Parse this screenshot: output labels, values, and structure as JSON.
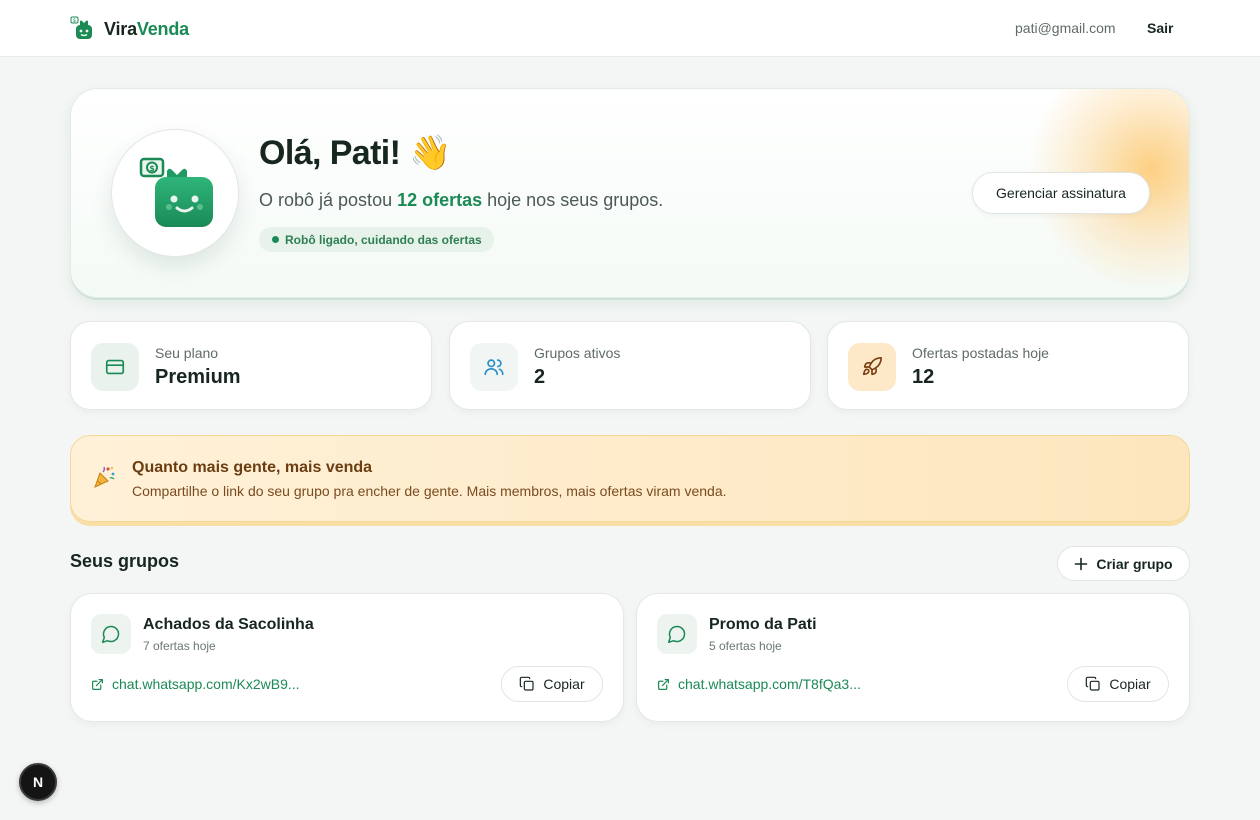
{
  "header": {
    "brand_part1": "Vira",
    "brand_part2": "Venda",
    "user_email": "pati@gmail.com",
    "logout_label": "Sair"
  },
  "hero": {
    "greeting": "Olá, Pati!",
    "greeting_emoji": "👋",
    "subtitle_prefix": "O robô já postou ",
    "subtitle_highlight": "12 ofertas",
    "subtitle_suffix": " hoje nos seus grupos.",
    "status_label": "Robô ligado, cuidando das ofertas",
    "manage_button": "Gerenciar assinatura"
  },
  "stats": [
    {
      "label": "Seu plano",
      "value": "Premium",
      "icon": "credit-card-icon"
    },
    {
      "label": "Grupos ativos",
      "value": "2",
      "icon": "users-icon"
    },
    {
      "label": "Ofertas postadas hoje",
      "value": "12",
      "icon": "rocket-icon"
    }
  ],
  "tip": {
    "title": "Quanto mais gente, mais venda",
    "text": "Compartilhe o link do seu grupo pra encher de gente. Mais membros, mais ofertas viram venda.",
    "icon": "party-popper-icon"
  },
  "groups_section": {
    "title": "Seus grupos",
    "create_button": "Criar grupo"
  },
  "groups": [
    {
      "name": "Achados da Sacolinha",
      "offers_today": "7 ofertas hoje",
      "link": "chat.whatsapp.com/Kx2wB9...",
      "copy_label": "Copiar"
    },
    {
      "name": "Promo da Pati",
      "offers_today": "5 ofertas hoje",
      "link": "chat.whatsapp.com/T8fQa3...",
      "copy_label": "Copiar"
    }
  ],
  "dev_badge": "N",
  "colors": {
    "brand_green": "#1b8a55",
    "background": "#f3f6f4",
    "tip_background": "#fde6bd"
  }
}
